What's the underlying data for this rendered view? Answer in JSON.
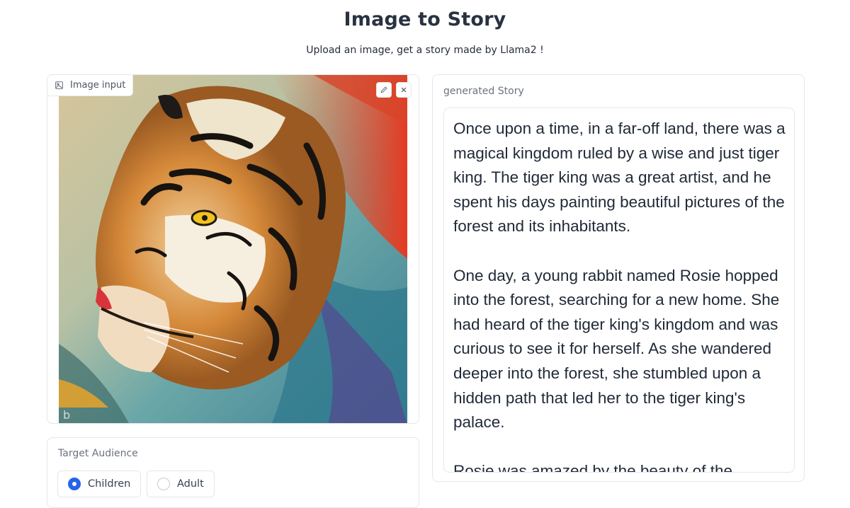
{
  "header": {
    "title": "Image to Story",
    "subtitle": "Upload an image, get a story made by Llama2 !"
  },
  "image_input": {
    "label": "Image input",
    "label_icon": "image-icon",
    "edit_icon": "pencil-icon",
    "clear_icon": "close-icon"
  },
  "audience": {
    "label": "Target Audience",
    "options": [
      {
        "label": "Children",
        "selected": true
      },
      {
        "label": "Adult",
        "selected": false
      }
    ]
  },
  "story": {
    "label": "generated Story",
    "text": "Once upon a time, in a far-off land, there was a magical kingdom ruled by a wise and just tiger king. The tiger king was a great artist, and he spent his days painting beautiful pictures of the forest and its inhabitants.\n\nOne day, a young rabbit named Rosie hopped into the forest, searching for a new home. She had heard of the tiger king's kingdom and was curious to see it for herself. As she wandered deeper into the forest, she stumbled upon a hidden path that led her to the tiger king's palace.\n\nRosie was amazed by the beauty of the"
  },
  "colors": {
    "accent": "#2563eb",
    "border": "#e5e7eb",
    "label": "#6b7280"
  }
}
